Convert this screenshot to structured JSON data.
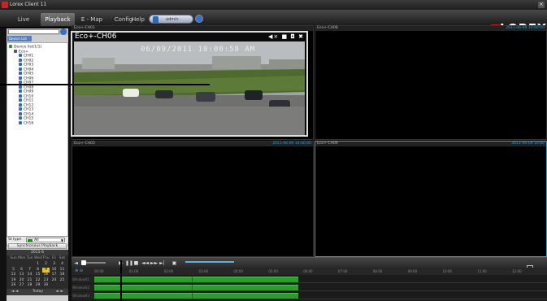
{
  "window": {
    "title": "Lorex Client 11",
    "close": "×"
  },
  "menu": {
    "tabs": [
      {
        "label": "Live"
      },
      {
        "label": "Playback"
      },
      {
        "label": "E - Map"
      },
      {
        "label": "Config"
      },
      {
        "label": "Help"
      }
    ],
    "active_tab": "Playback",
    "user": "admin"
  },
  "brand": {
    "logo": "LOREX",
    "accent": "#cc1111"
  },
  "sidebar": {
    "tab_label": "Device List",
    "tree": {
      "root": "Device list(1/1)",
      "device": "Eco+",
      "channels": [
        "CH01",
        "CH02",
        "CH03",
        "CH04",
        "CH05",
        "CH06",
        "CH07",
        "CH08",
        "CH09",
        "CH10",
        "CH11",
        "CH12",
        "CH13",
        "CH14",
        "CH15",
        "CH16"
      ]
    },
    "stype_label": "St type",
    "stype_value": "All",
    "sync_label": "Synchronous Playback",
    "calendar": {
      "title": "2011-6",
      "weekdays": [
        "Sun",
        "Mon",
        "Tue",
        "Wed",
        "Thu",
        "Fri",
        "Sat"
      ],
      "weeks": [
        [
          "",
          "",
          "",
          "1",
          "2",
          "3",
          "4"
        ],
        [
          "5",
          "6",
          "7",
          "8",
          "9",
          "10",
          "11"
        ],
        [
          "12",
          "13",
          "14",
          "15",
          "16",
          "17",
          "18"
        ],
        [
          "19",
          "20",
          "21",
          "22",
          "23",
          "24",
          "25"
        ],
        [
          "26",
          "27",
          "28",
          "29",
          "30",
          "",
          ""
        ]
      ],
      "highlighted": "9",
      "prev": "◄ ◄",
      "today": "Today",
      "next": "► ►"
    }
  },
  "tiles": [
    {
      "name": "Eco+-CH01",
      "time": ""
    },
    {
      "name": "Eco+-CH08",
      "time": "2011-06-09 10:00:00"
    },
    {
      "name": "Eco+-CH03",
      "time": "2011-06-09 10:00:00"
    },
    {
      "name": "Eco+-CH09",
      "time": "2011-06-09 10:00"
    }
  ],
  "popup": {
    "title": "Eco+-CH06",
    "osd": "06/09/2011 10:00:58 AM",
    "icons": "◀× ■ ◘ ✖"
  },
  "timeline": {
    "ticks": [
      "00:00",
      "01:00",
      "02:00",
      "03:00",
      "04:00",
      "05:00",
      "06:00",
      "07:00",
      "08:00",
      "09:00",
      "10:00",
      "11:00",
      "12:00"
    ],
    "rows": [
      "Window01",
      "Window02",
      "Window03"
    ],
    "recording_fraction": 0.45
  },
  "colors": {
    "background": "#111111",
    "selected_border": "#3aa0c8",
    "recording": "#2f9a2f",
    "timestamp": "#2fa0d8"
  }
}
